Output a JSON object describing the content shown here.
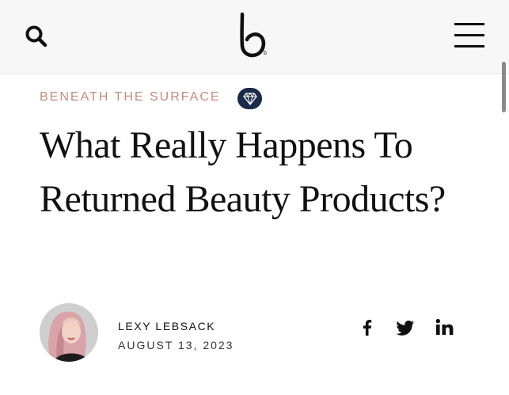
{
  "header": {
    "logo_text": "b"
  },
  "article": {
    "kicker": "BENEATH THE SURFACE",
    "title": "What Really Happens To Returned Beauty Products?"
  },
  "byline": {
    "author": "LEXY LEBSACK",
    "date": "AUGUST 13, 2023"
  },
  "icons": {
    "search": "search-icon",
    "menu": "hamburger-menu-icon",
    "badge": "diamond-icon",
    "facebook": "facebook-icon",
    "twitter": "twitter-icon",
    "linkedin": "linkedin-icon"
  },
  "colors": {
    "kicker": "#c98a7e",
    "badge_bg": "#1b2a4a",
    "text": "#111111"
  }
}
